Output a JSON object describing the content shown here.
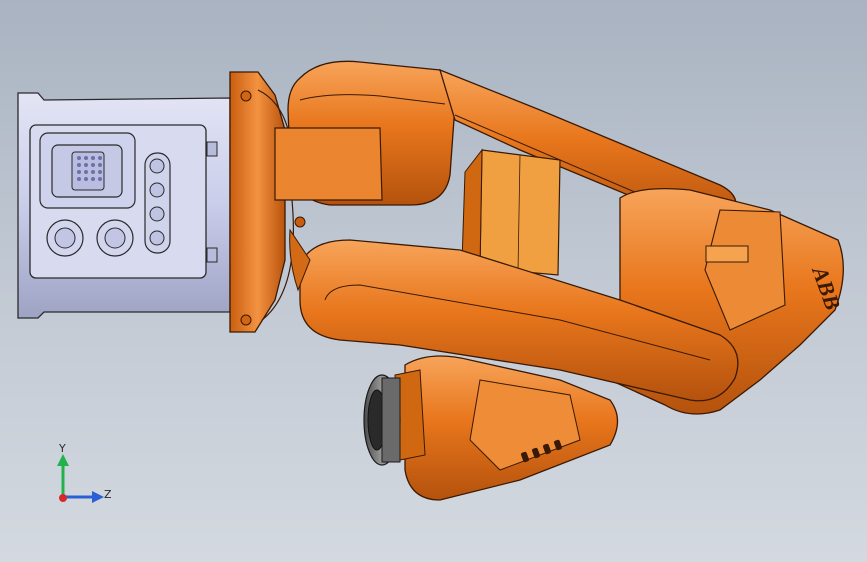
{
  "viewport": {
    "model_name": "",
    "background_top": "#a9b3c1",
    "background_bottom": "#d4d9e0"
  },
  "model": {
    "logo_text": "ABB",
    "body_color": "#e8761c",
    "body_dark": "#a8480a",
    "body_light": "#f7a45a",
    "motor_color": "#c9cdea"
  },
  "triad": {
    "y_label": "Y",
    "z_label": "Z",
    "y_color": "#22b24c",
    "z_color": "#2a5fd6",
    "x_color": "#d62a2a"
  }
}
